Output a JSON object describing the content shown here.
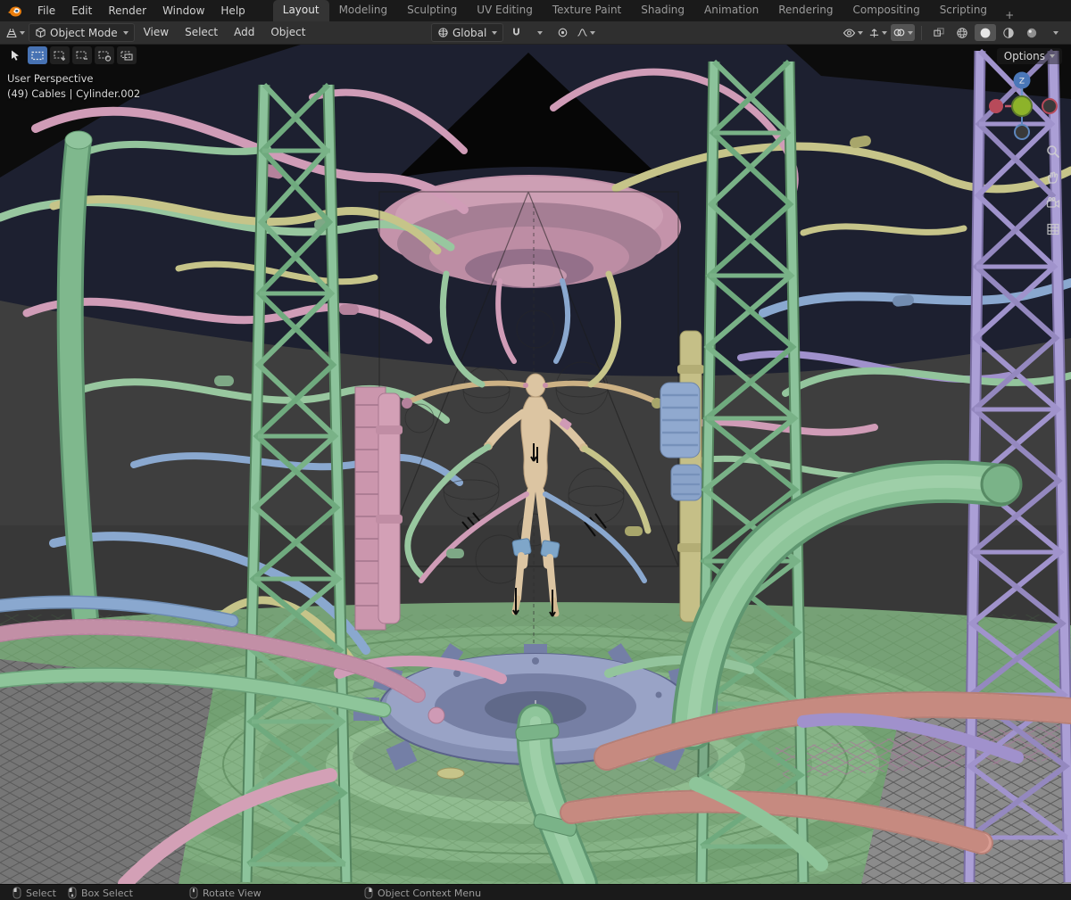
{
  "topbar": {
    "menus": [
      "File",
      "Edit",
      "Render",
      "Window",
      "Help"
    ],
    "tabs": [
      "Layout",
      "Modeling",
      "Sculpting",
      "UV Editing",
      "Texture Paint",
      "Shading",
      "Animation",
      "Rendering",
      "Compositing",
      "Scripting"
    ],
    "active_tab": "Layout",
    "add_tab": "+"
  },
  "header": {
    "mode": "Object Mode",
    "menus": [
      "View",
      "Select",
      "Add",
      "Object"
    ],
    "orientation": "Global"
  },
  "tool_row": {
    "options": "Options"
  },
  "viewport": {
    "view_label": "User Perspective",
    "selection_label": "(49) Cables | Cylinder.002"
  },
  "gizmo": {
    "z_label": "Z"
  },
  "statusbar": {
    "items": [
      {
        "icon": "left-mouse-button",
        "label": "Select"
      },
      {
        "icon": "left-mouse-drag",
        "label": "Box Select"
      },
      {
        "icon": "middle-mouse-button",
        "label": "Rotate View"
      },
      {
        "icon": "right-mouse-button",
        "label": "Object Context Menu"
      }
    ]
  },
  "icons": {
    "blender-logo": "orange-blender-mark",
    "chevron-down": "css-triangle",
    "editor-type": "grid-perspective",
    "object-mode": "cube-outline",
    "transform-orientation": "globe",
    "snap": "magnet",
    "proportional-editing": "circle-dot",
    "falloff": "wave-curve",
    "visibility": "eye",
    "gizmos": "axis-arrow",
    "overlays": "two-circles",
    "xray": "overlapping-squares",
    "shading-wireframe": "wire-sphere",
    "shading-solid": "solid-sphere",
    "shading-material": "half-sphere",
    "shading-rendered": "shaded-sphere",
    "zoom": "magnifier",
    "move-view": "hand",
    "camera-view": "camera",
    "toggle-ortho": "grid"
  },
  "colors": {
    "accent_blue": "#4772b3",
    "truss_green": "#8cc39b",
    "truss_purple": "#ab9fd6",
    "disc_pink": "#c493aa",
    "skin": "#dcc5a2",
    "gear_blue": "#848eb2",
    "floor_green": "#76a176",
    "sky_navy": "#1d2030",
    "cable_pink": "#d09cb7",
    "cable_yellow": "#c6c489",
    "cable_blue": "#8aa8cf",
    "cable_purple": "#a091cc"
  }
}
